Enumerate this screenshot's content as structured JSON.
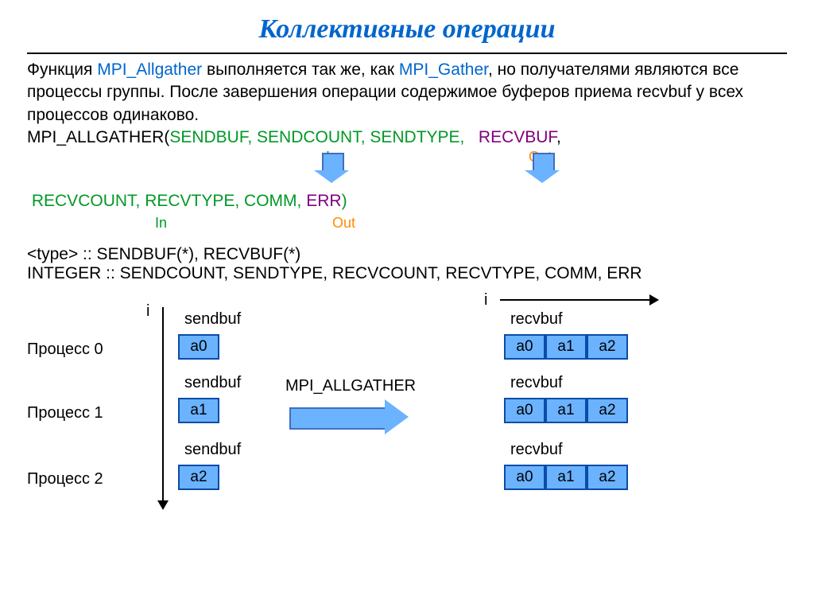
{
  "title": "Коллективные операции",
  "para": {
    "t1": "Функция ",
    "fn1": "MPI_Allgather",
    "t2": " выполняется так же, как ",
    "fn2": "MPI_Gather",
    "t3": ", но получателями являются все процессы группы.  После завершения операции содержимое буферов приема recvbuf у всех процессов одинаково.",
    "prefix": "MPI_ALLGATHER(",
    "args_green1": "SENDBUF,  SENDCOUNT, SENDTYPE,",
    "recvbuf": "RECVBUF",
    "comma1": ",",
    "args_green2": "RECVCOUNT, RECVTYPE,  COMM,",
    "err": "ERR",
    "paren": ")"
  },
  "annot": {
    "in": "In",
    "out": "Out"
  },
  "decl": {
    "l1": "<type>  :: SENDBUF(*), RECVBUF(*)",
    "l2": "INTEGER :: SENDCOUNT, SENDTYPE,  RECVCOUNT, RECVTYPE,  COMM, ERR"
  },
  "diagram": {
    "i": "i",
    "sendbuf": "sendbuf",
    "recvbuf": "recvbuf",
    "op": "MPI_ALLGATHER",
    "proc": [
      "Процесс 0",
      "Процесс 1",
      "Процесс 2"
    ],
    "sendcells": [
      "a0",
      "a1",
      "a2"
    ],
    "recvcells": [
      "a0",
      "a1",
      "a2"
    ]
  }
}
